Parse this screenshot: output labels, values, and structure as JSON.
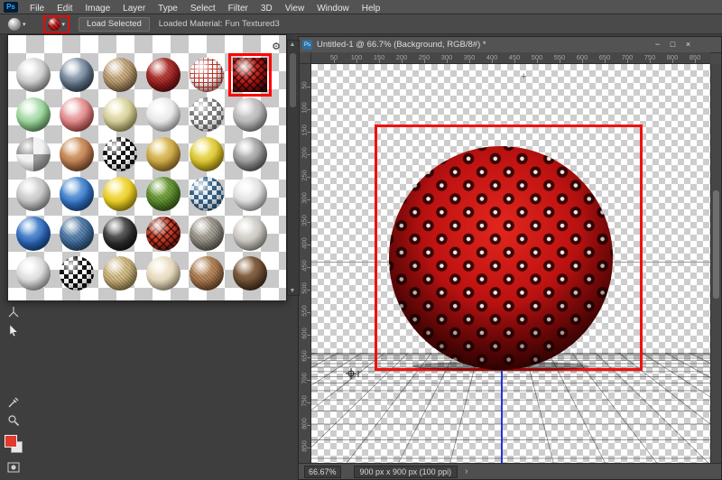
{
  "menu_bar": {
    "logo_text": "Ps",
    "items": [
      "File",
      "Edit",
      "Image",
      "Layer",
      "Type",
      "Select",
      "Filter",
      "3D",
      "View",
      "Window",
      "Help"
    ]
  },
  "options_bar": {
    "load_selected": "Load Selected",
    "loaded_material": "Loaded Material: Fun Textured3"
  },
  "icons": {
    "gear": "⚙",
    "caret": "▾",
    "chevron": "›",
    "plus": "+",
    "scroll_up": "▲",
    "scroll_down": "▼"
  },
  "annotations": {
    "highlight_color": "#ff0000"
  },
  "materials_panel": {
    "selected_index": 5,
    "materials": [
      {
        "name": "silver",
        "base": "#c6c6c6",
        "light": "#ffffff",
        "dark": "#6f6f6f",
        "pattern": "solid"
      },
      {
        "name": "blue-steel",
        "base": "#5f7288",
        "light": "#d5dde5",
        "dark": "#1f2c3a",
        "pattern": "solid"
      },
      {
        "name": "wood",
        "base": "#b4946a",
        "light": "#e6d2ab",
        "dark": "#64502e",
        "pattern": "texture"
      },
      {
        "name": "red-rough",
        "base": "#9e1f1f",
        "light": "#d6685c",
        "dark": "#420707",
        "pattern": "texture"
      },
      {
        "name": "red-wire",
        "base": "#f0f0f0",
        "light": "#ffffff",
        "dark": "#c23028",
        "pattern": "wire"
      },
      {
        "name": "fun-textured3",
        "base": "#b01412",
        "light": "#e6554a",
        "dark": "#4e0404",
        "pattern": "mesh"
      },
      {
        "name": "green-glass",
        "base": "#90cc90",
        "light": "#eafdea",
        "dark": "#3c7a3c",
        "pattern": "solid"
      },
      {
        "name": "rose-glass",
        "base": "#d87a7a",
        "light": "#ffe0e0",
        "dark": "#8c2424",
        "pattern": "solid"
      },
      {
        "name": "amber-glass",
        "base": "#cdc68e",
        "light": "#fdf8da",
        "dark": "#857c3e",
        "pattern": "solid"
      },
      {
        "name": "clear-glass",
        "base": "#e4e4e4",
        "light": "#ffffff",
        "dark": "#979797",
        "pattern": "solid"
      },
      {
        "name": "mirror-checker",
        "base": "#cfcfcf",
        "light": "#ffffff",
        "dark": "#7d7d7d",
        "pattern": "checker"
      },
      {
        "name": "gray-matte",
        "base": "#b2b2b2",
        "light": "#dedede",
        "dark": "#696969",
        "pattern": "solid"
      },
      {
        "name": "flat-checker",
        "base": "#cccccc",
        "light": "#f2f2f2",
        "dark": "#9b9b9b",
        "pattern": "checker-large"
      },
      {
        "name": "copper",
        "base": "#b5764a",
        "light": "#eec091",
        "dark": "#5a3014",
        "pattern": "solid"
      },
      {
        "name": "bw-checker",
        "base": "#d0d0d0",
        "light": "#ffffff",
        "dark": "#141414",
        "pattern": "checker"
      },
      {
        "name": "gold",
        "base": "#c6a03e",
        "light": "#f3df8e",
        "dark": "#6d520f",
        "pattern": "solid"
      },
      {
        "name": "yellow-gloss",
        "base": "#d4bd23",
        "light": "#fdf49e",
        "dark": "#776708",
        "pattern": "solid"
      },
      {
        "name": "graphite",
        "base": "#8e8e8e",
        "light": "#e2e2e2",
        "dark": "#3c3c3c",
        "pattern": "solid"
      },
      {
        "name": "light-gray",
        "base": "#bfbfbf",
        "light": "#efefef",
        "dark": "#757575",
        "pattern": "solid"
      },
      {
        "name": "blue-gloss",
        "base": "#2f6fbe",
        "light": "#9cc5ef",
        "dark": "#113968",
        "pattern": "solid"
      },
      {
        "name": "yellow-bright",
        "base": "#e5c81f",
        "light": "#fff085",
        "dark": "#857107",
        "pattern": "solid"
      },
      {
        "name": "grass",
        "base": "#5a8a2b",
        "light": "#9cc762",
        "dark": "#294a0f",
        "pattern": "texture"
      },
      {
        "name": "blue-tile",
        "base": "#7fa9c9",
        "light": "#ddebf6",
        "dark": "#39607f",
        "pattern": "checker"
      },
      {
        "name": "white-matte",
        "base": "#dadada",
        "light": "#ffffff",
        "dark": "#929292",
        "pattern": "solid"
      },
      {
        "name": "blue-plastic",
        "base": "#2a63b6",
        "light": "#8ab8e8",
        "dark": "#0e3463",
        "pattern": "solid"
      },
      {
        "name": "denim",
        "base": "#406e9f",
        "light": "#8caac7",
        "dark": "#1b3956",
        "pattern": "texture"
      },
      {
        "name": "black-gloss",
        "base": "#2c2c2c",
        "light": "#8f8f8f",
        "dark": "#030303",
        "pattern": "solid"
      },
      {
        "name": "red-mesh",
        "base": "#bf3020",
        "light": "#e87252",
        "dark": "#4e0a04",
        "pattern": "mesh"
      },
      {
        "name": "stone",
        "base": "#8e897f",
        "light": "#cdc8be",
        "dark": "#4c4840",
        "pattern": "texture"
      },
      {
        "name": "concrete",
        "base": "#c4c1bb",
        "light": "#efede7",
        "dark": "#7c7973",
        "pattern": "solid"
      },
      {
        "name": "white-gloss",
        "base": "#d4d4d4",
        "light": "#ffffff",
        "dark": "#888888",
        "pattern": "solid"
      },
      {
        "name": "bw-checker-2",
        "base": "#dedede",
        "light": "#ffffff",
        "dark": "#101010",
        "pattern": "checker"
      },
      {
        "name": "sand",
        "base": "#c7ae77",
        "light": "#ecdaa9",
        "dark": "#7b6536",
        "pattern": "texture"
      },
      {
        "name": "cream",
        "base": "#e0d3b6",
        "light": "#fdf6e5",
        "dark": "#978a66",
        "pattern": "solid"
      },
      {
        "name": "cork",
        "base": "#a5744a",
        "light": "#d6ac7e",
        "dark": "#58371b",
        "pattern": "texture"
      },
      {
        "name": "bronze",
        "base": "#684931",
        "light": "#a57f5c",
        "dark": "#2b1706",
        "pattern": "solid"
      }
    ]
  },
  "document_window": {
    "title": "Untitled-1 @ 66.7% (Background, RGB/8#) *",
    "controls": {
      "minimize": "−",
      "maximize": "□",
      "close": "×"
    },
    "h_ruler": [
      50,
      100,
      150,
      200,
      250,
      300,
      350,
      400,
      450,
      500,
      550,
      600,
      650,
      700,
      750,
      800,
      850
    ],
    "v_ruler": [
      50,
      100,
      150,
      200,
      250,
      300,
      350,
      400,
      450,
      500,
      550,
      600,
      650,
      700,
      750,
      800,
      850
    ],
    "status": {
      "zoom": "66.67%",
      "dims": "900 px x 900 px (100 ppi)"
    }
  },
  "canvas_scene": {
    "sphere_color": "#b61512",
    "frame_color": "#ff0000",
    "horizon_color": "#9b9b9b",
    "axis_line_color": "#2233dd"
  }
}
